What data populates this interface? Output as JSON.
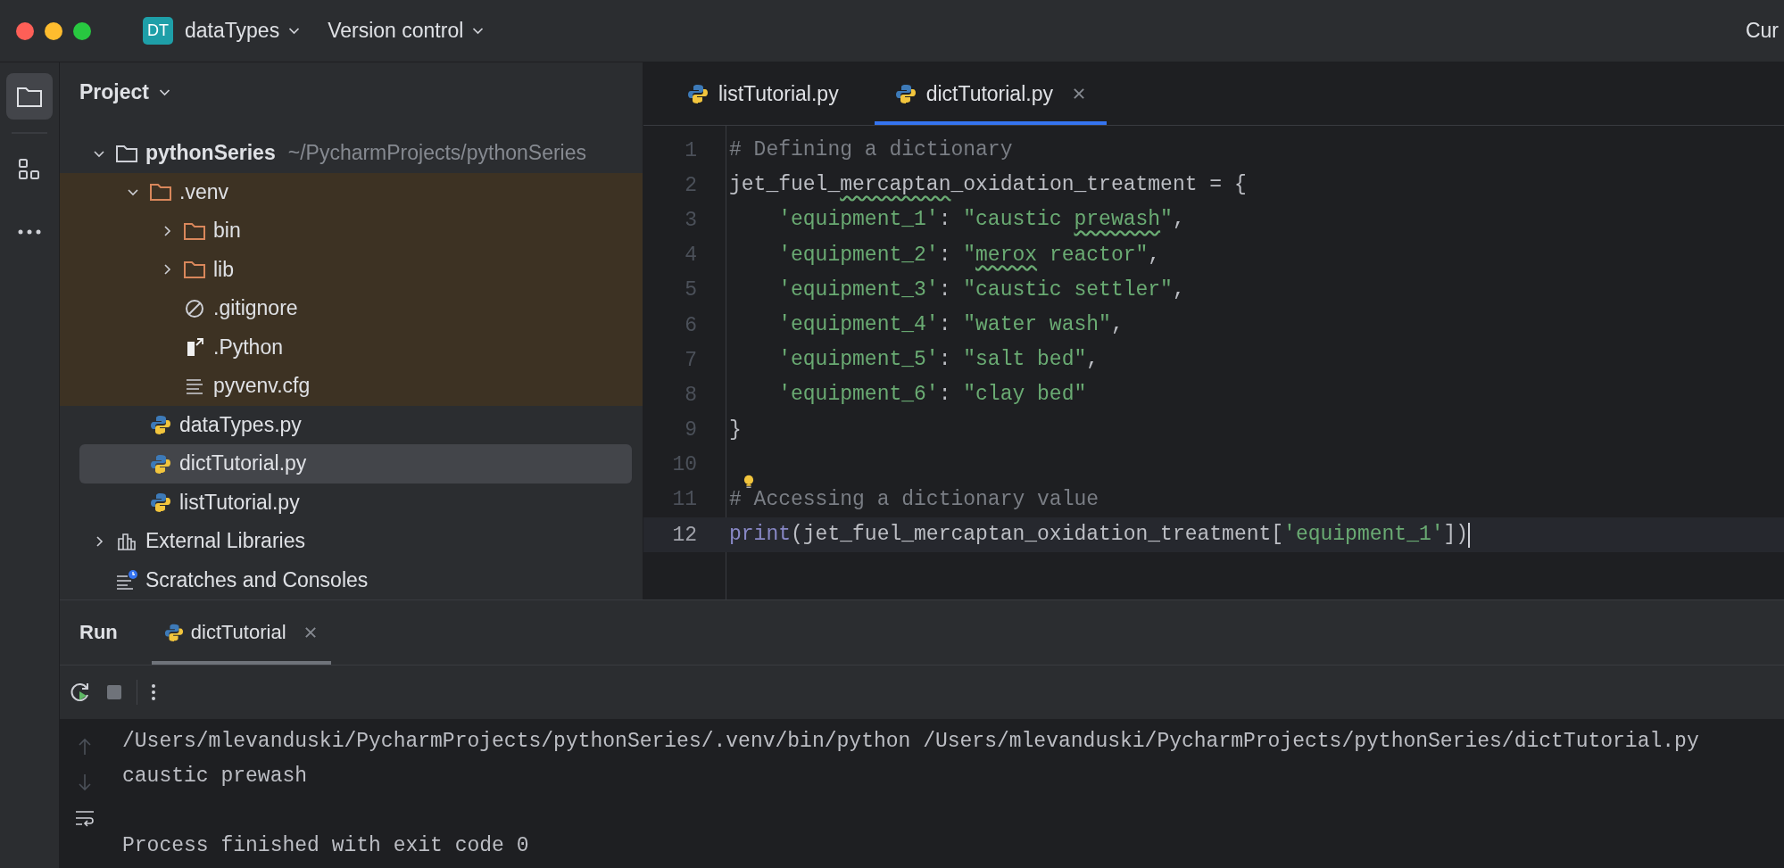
{
  "title_bar": {
    "project_badge": "DT",
    "project_name": "dataTypes",
    "vcs_label": "Version control",
    "right_text": "Cur"
  },
  "project_panel": {
    "title": "Project",
    "tree": [
      {
        "label": "pythonSeries",
        "path": "~/PycharmProjects/pythonSeries",
        "kind": "folder",
        "expanded": true,
        "selected": false,
        "excluded": false,
        "children": [
          {
            "label": ".venv",
            "kind": "folder",
            "expanded": true,
            "selected": false,
            "excluded": true,
            "children": [
              {
                "label": "bin",
                "kind": "folder",
                "expanded": false,
                "selected": false,
                "excluded": true
              },
              {
                "label": "lib",
                "kind": "folder",
                "expanded": false,
                "selected": false,
                "excluded": true
              },
              {
                "label": ".gitignore",
                "kind": "ignore",
                "selected": false,
                "excluded": true
              },
              {
                "label": ".Python",
                "kind": "link",
                "selected": false,
                "excluded": true
              },
              {
                "label": "pyvenv.cfg",
                "kind": "text",
                "selected": false,
                "excluded": true
              }
            ]
          },
          {
            "label": "dataTypes.py",
            "kind": "python",
            "selected": false,
            "excluded": false
          },
          {
            "label": "dictTutorial.py",
            "kind": "python",
            "selected": true,
            "excluded": false
          },
          {
            "label": "listTutorial.py",
            "kind": "python",
            "selected": false,
            "excluded": false
          }
        ]
      },
      {
        "label": "External Libraries",
        "kind": "library",
        "expanded": false,
        "selected": false,
        "excluded": false
      },
      {
        "label": "Scratches and Consoles",
        "kind": "scratches",
        "selected": false,
        "excluded": false
      }
    ]
  },
  "editor": {
    "tabs": [
      {
        "label": "listTutorial.py",
        "selected": false
      },
      {
        "label": "dictTutorial.py",
        "selected": true
      }
    ],
    "lines": [
      {
        "number": "1",
        "current": false,
        "tokens": [
          {
            "kind": "comment",
            "text": "# Defining a dictionary"
          }
        ]
      },
      {
        "number": "2",
        "current": false,
        "tokens": [
          {
            "kind": "ident",
            "text": "jet_fuel_"
          },
          {
            "kind": "ident",
            "text": "mercaptan",
            "typo": true
          },
          {
            "kind": "ident",
            "text": "_oxidation_treatment = {"
          }
        ]
      },
      {
        "number": "3",
        "current": false,
        "tokens": [
          {
            "kind": "string",
            "text": "    'equipment_1'"
          },
          {
            "kind": "ident",
            "text": ": "
          },
          {
            "kind": "string",
            "text": "\"caustic "
          },
          {
            "kind": "string",
            "text": "prewash",
            "typo": true
          },
          {
            "kind": "string",
            "text": "\""
          },
          {
            "kind": "ident",
            "text": ","
          }
        ]
      },
      {
        "number": "4",
        "current": false,
        "tokens": [
          {
            "kind": "string",
            "text": "    'equipment_2'"
          },
          {
            "kind": "ident",
            "text": ": "
          },
          {
            "kind": "string",
            "text": "\""
          },
          {
            "kind": "string",
            "text": "merox",
            "typo": true
          },
          {
            "kind": "string",
            "text": " reactor\""
          },
          {
            "kind": "ident",
            "text": ","
          }
        ]
      },
      {
        "number": "5",
        "current": false,
        "tokens": [
          {
            "kind": "string",
            "text": "    'equipment_3'"
          },
          {
            "kind": "ident",
            "text": ": "
          },
          {
            "kind": "string",
            "text": "\"caustic settler\""
          },
          {
            "kind": "ident",
            "text": ","
          }
        ]
      },
      {
        "number": "6",
        "current": false,
        "tokens": [
          {
            "kind": "string",
            "text": "    'equipment_4'"
          },
          {
            "kind": "ident",
            "text": ": "
          },
          {
            "kind": "string",
            "text": "\"water wash\""
          },
          {
            "kind": "ident",
            "text": ","
          }
        ]
      },
      {
        "number": "7",
        "current": false,
        "tokens": [
          {
            "kind": "string",
            "text": "    'equipment_5'"
          },
          {
            "kind": "ident",
            "text": ": "
          },
          {
            "kind": "string",
            "text": "\"salt bed\""
          },
          {
            "kind": "ident",
            "text": ","
          }
        ]
      },
      {
        "number": "8",
        "current": false,
        "tokens": [
          {
            "kind": "string",
            "text": "    'equipment_6'"
          },
          {
            "kind": "ident",
            "text": ": "
          },
          {
            "kind": "string",
            "text": "\"clay bed\""
          }
        ]
      },
      {
        "number": "9",
        "current": false,
        "tokens": [
          {
            "kind": "ident",
            "text": "}"
          }
        ]
      },
      {
        "number": "10",
        "current": false
      },
      {
        "number": "11",
        "current": false,
        "bulb": true,
        "tokens": [
          {
            "kind": "comment",
            "text": "# Accessing a dictionary value"
          }
        ]
      },
      {
        "number": "12",
        "current": true,
        "tokens": [
          {
            "kind": "builtin",
            "text": "print"
          },
          {
            "kind": "ident",
            "text": "(jet_fuel_mercaptan_oxidation_treatment["
          },
          {
            "kind": "string",
            "text": "'equipment_1'"
          },
          {
            "kind": "ident",
            "text": "])"
          }
        ]
      }
    ]
  },
  "run_panel": {
    "title": "Run",
    "tab": "dictTutorial",
    "output": [
      "/Users/mlevanduski/PycharmProjects/pythonSeries/.venv/bin/python /Users/mlevanduski/PycharmProjects/pythonSeries/dictTutorial.py",
      "caustic prewash"
    ],
    "exit_message": "Process finished with exit code 0"
  }
}
